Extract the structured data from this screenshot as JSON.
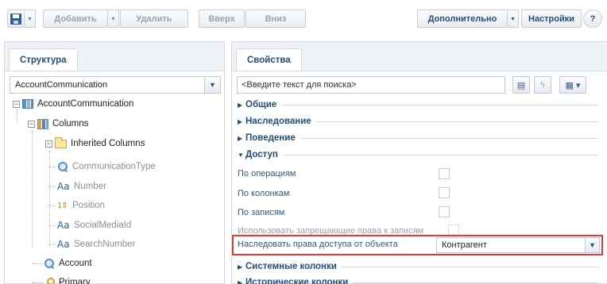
{
  "toolbar": {
    "add_label": "Добавить",
    "delete_label": "Удалить",
    "up_label": "Вверх",
    "down_label": "Вниз",
    "additional_label": "Дополнительно",
    "settings_label": "Настройки",
    "help_glyph": "?"
  },
  "structure": {
    "tab_label": "Структура",
    "selected_object": "AccountCommunication",
    "tree": {
      "root": "AccountCommunication",
      "columns": "Columns",
      "inherited": "Inherited Columns",
      "items": [
        {
          "label": "CommunicationType",
          "icon": "lookup-icon"
        },
        {
          "label": "Number",
          "icon": "text-icon"
        },
        {
          "label": "Position",
          "icon": "integer-icon"
        },
        {
          "label": "SocialMediaId",
          "icon": "text-icon"
        },
        {
          "label": "SearchNumber",
          "icon": "text-icon"
        }
      ],
      "account": "Account",
      "primary": "Primary"
    }
  },
  "properties": {
    "tab_label": "Свойства",
    "search_placeholder": "<Введите текст для поиска>",
    "sections": {
      "general": "Общие",
      "inheritance": "Наследование",
      "behavior": "Поведение",
      "access": "Доступ",
      "system_columns": "Системные колонки",
      "history_columns": "Исторические колонки"
    },
    "access": {
      "by_operations": "По операциям",
      "by_columns": "По колонкам",
      "by_records": "По записям",
      "deny_rights": "Использовать запрещающие права к записям",
      "inherit_label": "Наследовать права доступа от объекта",
      "inherit_value": "Контрагент"
    }
  },
  "colors": {
    "accent": "#1f4d86",
    "highlight": "#e53935"
  }
}
